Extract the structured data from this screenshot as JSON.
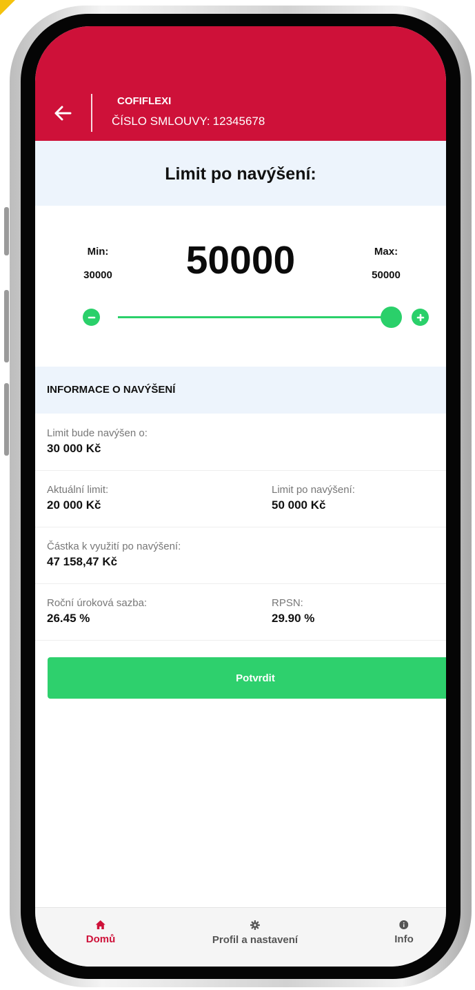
{
  "header": {
    "app_name": "COFIFLEXI",
    "contract_label": "ČÍSLO SMLOUVY:",
    "contract_number": "12345678"
  },
  "limit": {
    "title": "Limit po navýšení:",
    "current_value": "50000",
    "min_label": "Min:",
    "min_value": "30000",
    "max_label": "Max:",
    "max_value": "50000",
    "slider_fraction": 1.0
  },
  "info": {
    "section_title": "INFORMACE O NAVÝŠENÍ",
    "increase_label": "Limit bude navýšen o:",
    "increase_value": "30 000 Kč",
    "current_limit_label": "Aktuální limit:",
    "current_limit_value": "20 000 Kč",
    "new_limit_label": "Limit po navýšení:",
    "new_limit_value": "50 000 Kč",
    "usable_label": "Částka k využití po navýšení:",
    "usable_value": "47 158,47 Kč",
    "rate_label": "Roční úroková sazba:",
    "rate_value": "26.45 %",
    "rpsn_label": "RPSN:",
    "rpsn_value": "29.90 %"
  },
  "actions": {
    "confirm_label": "Potvrdit"
  },
  "bottom_nav": {
    "home_label": "Domů",
    "profile_label": "Profil a nastavení",
    "info_label": "Info"
  },
  "colors": {
    "brand": "#ce1139",
    "accent_green": "#2ad06a",
    "band_bg": "#edf4fc"
  },
  "icons": {
    "back": "arrow-left-icon",
    "decrease": "minus-icon",
    "increase": "plus-icon",
    "home": "home-icon",
    "profile": "gear-icon",
    "info": "info-icon"
  }
}
